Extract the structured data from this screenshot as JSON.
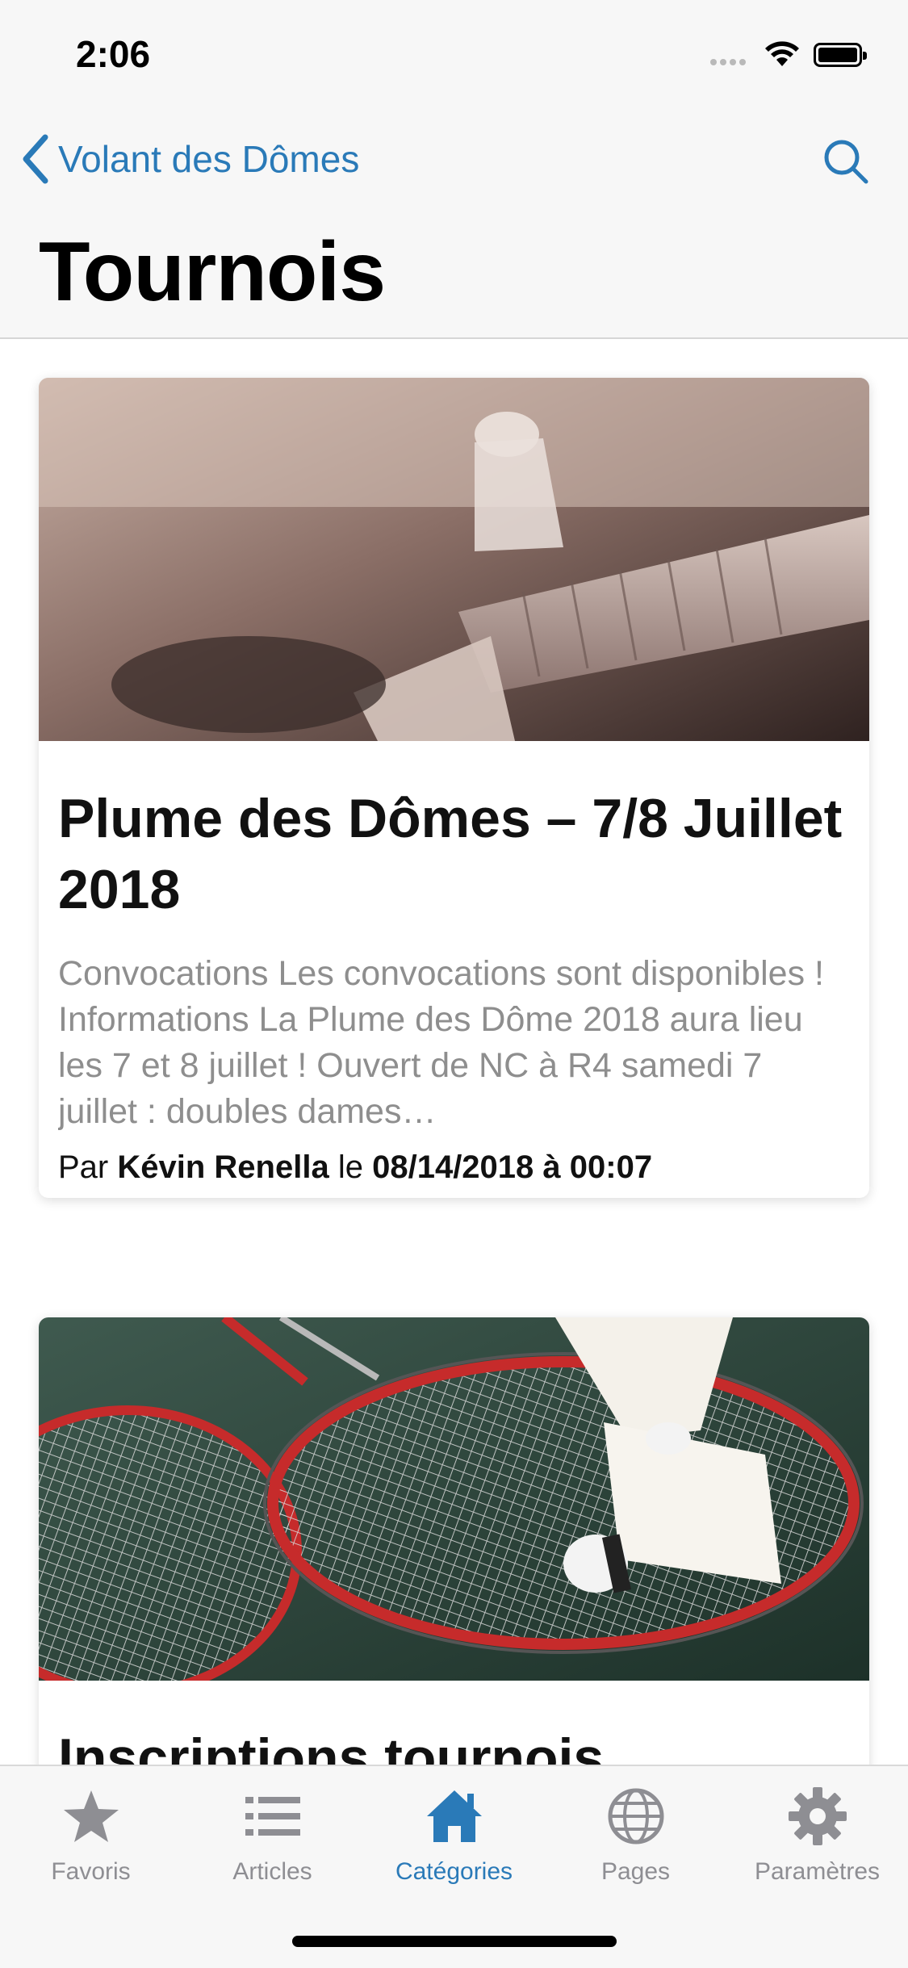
{
  "status": {
    "time": "2:06"
  },
  "nav": {
    "back_label": "Volant des Dômes"
  },
  "page": {
    "title": "Tournois"
  },
  "posts": [
    {
      "title": "Plume des Dômes – 7/8 Juillet 2018",
      "excerpt": "Convocations Les convocations sont disponibles !   Informations La Plume des Dôme 2018 aura lieu les 7 et 8 juillet ! Ouvert de NC à R4 samedi 7 juillet : doubles dames…",
      "by_label": "Par",
      "author": "Kévin Renella",
      "on_label": "le",
      "date": "08/14/2018 à 00:07"
    },
    {
      "title": "Inscriptions tournois"
    }
  ],
  "tabs": [
    {
      "label": "Favoris",
      "icon": "star-icon"
    },
    {
      "label": "Articles",
      "icon": "list-icon"
    },
    {
      "label": "Catégories",
      "icon": "home-icon",
      "active": true
    },
    {
      "label": "Pages",
      "icon": "globe-icon"
    },
    {
      "label": "Paramètres",
      "icon": "gear-icon"
    }
  ],
  "colors": {
    "accent": "#2a7ab8",
    "tab_inactive": "#8e8e93"
  }
}
